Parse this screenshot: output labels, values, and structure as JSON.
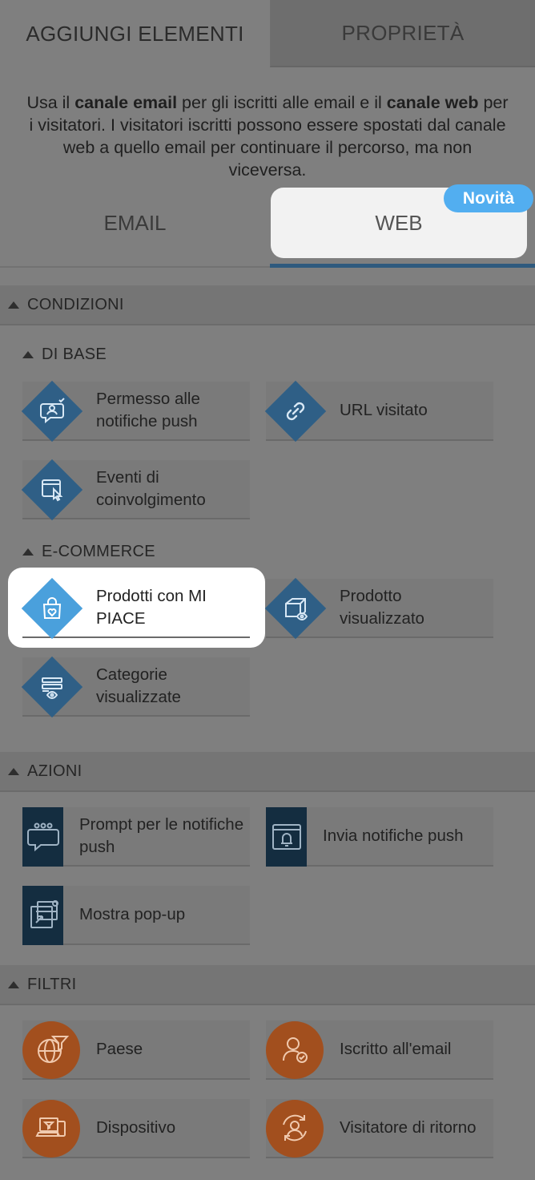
{
  "top_tabs": {
    "add_elements": "AGGIUNGI ELEMENTI",
    "properties": "PROPRIETÀ"
  },
  "intro": {
    "p1": "Usa il ",
    "b1": "canale email",
    "p2": " per gli iscritti alle email e il ",
    "b2": "canale web",
    "p3": " per i visitatori. I visitatori iscritti possono essere spostati dal canale web a quello email per continuare il percorso, ma non viceversa."
  },
  "channels": {
    "email": "EMAIL",
    "web": "WEB",
    "new_badge": "Novità"
  },
  "conditions": {
    "header": "CONDIZIONI",
    "basic": {
      "header": "DI BASE",
      "items": [
        {
          "label": "Permesso alle notifiche push",
          "icon": "chat-check-icon"
        },
        {
          "label": "URL visitato",
          "icon": "link-icon"
        },
        {
          "label": "Eventi di coinvolgimento",
          "icon": "click-window-icon"
        }
      ]
    },
    "ecommerce": {
      "header": "E-COMMERCE",
      "items": [
        {
          "label": "Prodotti con MI PIACE",
          "icon": "bag-heart-icon"
        },
        {
          "label": "Prodotto visualizzato",
          "icon": "box-eye-icon"
        },
        {
          "label": "Categorie visualizzate",
          "icon": "list-eye-icon"
        }
      ]
    }
  },
  "actions": {
    "header": "AZIONI",
    "items": [
      {
        "label": "Prompt per le notifiche push",
        "icon": "chat-prompt-icon"
      },
      {
        "label": "Invia notifiche push",
        "icon": "bell-window-icon"
      },
      {
        "label": "Mostra pop-up",
        "icon": "popup-icon"
      }
    ]
  },
  "filters": {
    "header": "FILTRI",
    "items": [
      {
        "label": "Paese",
        "icon": "globe-filter-icon"
      },
      {
        "label": "Iscritto all'email",
        "icon": "user-check-icon"
      },
      {
        "label": "Dispositivo",
        "icon": "devices-icon"
      },
      {
        "label": "Visitatore di ritorno",
        "icon": "user-return-icon"
      }
    ]
  },
  "colors": {
    "condition_icon": "#2f5f86",
    "condition_icon_highlight": "#4aa0dc",
    "action_icon": "#142d40",
    "filter_icon": "#a24f1e",
    "web_underline": "#2f5a7e",
    "badge": "#52aef0"
  }
}
